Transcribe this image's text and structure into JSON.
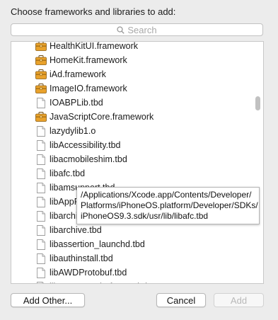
{
  "dialog": {
    "prompt": "Choose frameworks and libraries to add:",
    "search_placeholder": "Search"
  },
  "items": [
    {
      "label": "HealthKitUI.framework",
      "icon": "framework-icon"
    },
    {
      "label": "HomeKit.framework",
      "icon": "framework-icon"
    },
    {
      "label": "iAd.framework",
      "icon": "framework-icon"
    },
    {
      "label": "ImageIO.framework",
      "icon": "framework-icon"
    },
    {
      "label": "IOABPLib.tbd",
      "icon": "file-icon"
    },
    {
      "label": "JavaScriptCore.framework",
      "icon": "framework-icon"
    },
    {
      "label": "lazydylib1.o",
      "icon": "file-icon"
    },
    {
      "label": "libAccessibility.tbd",
      "icon": "file-icon"
    },
    {
      "label": "libacmobileshim.tbd",
      "icon": "file-icon"
    },
    {
      "label": "libafc.tbd",
      "icon": "file-icon"
    },
    {
      "label": "libamsupport.tbd",
      "icon": "file-icon"
    },
    {
      "label": "libAppP",
      "icon": "file-icon"
    },
    {
      "label": "libarchi",
      "icon": "file-icon"
    },
    {
      "label": "libarchive.tbd",
      "icon": "file-icon"
    },
    {
      "label": "libassertion_launchd.tbd",
      "icon": "file-icon"
    },
    {
      "label": "libauthinstall.tbd",
      "icon": "file-icon"
    },
    {
      "label": "libAWDProtobuf.tbd",
      "icon": "file-icon"
    },
    {
      "label": "libAWDProtobufAWD.tbd",
      "icon": "file-icon"
    }
  ],
  "tooltip": {
    "line1": "/Applications/Xcode.app/Contents/Developer/",
    "line2": "Platforms/iPhoneOS.platform/Developer/SDKs/",
    "line3": "iPhoneOS9.3.sdk/usr/lib/libafc.tbd"
  },
  "buttons": {
    "add_other": "Add Other...",
    "cancel": "Cancel",
    "add": "Add"
  },
  "colors": {
    "background": "#ececec",
    "framework_toolbox": "#e9a22b",
    "disabled_text": "#b8b8b8"
  }
}
